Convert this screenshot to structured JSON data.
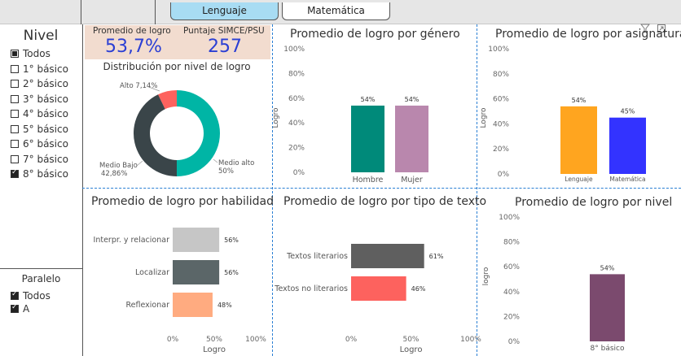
{
  "tabs": [
    {
      "label": "Lenguaje",
      "active": true
    },
    {
      "label": "Matemática",
      "active": false
    }
  ],
  "icons": {
    "filter": "filter-icon",
    "focus": "focus-mode-icon"
  },
  "sidebar": {
    "nivel_title": "Nivel",
    "nivel_items": [
      {
        "label": "Todos",
        "state": "partial"
      },
      {
        "label": "1° básico",
        "state": "unchecked"
      },
      {
        "label": "2° básico",
        "state": "unchecked"
      },
      {
        "label": "3° básico",
        "state": "unchecked"
      },
      {
        "label": "4° básico",
        "state": "unchecked"
      },
      {
        "label": "5° básico",
        "state": "unchecked"
      },
      {
        "label": "6° básico",
        "state": "unchecked"
      },
      {
        "label": "7° básico",
        "state": "unchecked"
      },
      {
        "label": "8° básico",
        "state": "checked"
      }
    ],
    "paralelo_title": "Paralelo",
    "paralelo_items": [
      {
        "label": "Todos",
        "state": "checked"
      },
      {
        "label": "A",
        "state": "checked"
      }
    ]
  },
  "kpi": {
    "logro_label": "Promedio de logro",
    "logro_value": "53,7%",
    "simce_label": "Puntaje SIMCE/PSU",
    "simce_value": "257"
  },
  "colors": {
    "accent": "#2b3fd4",
    "kpi_bg": "#f2dccf",
    "divider": "#2a7fd4"
  },
  "chart_data": [
    {
      "id": "distribucion",
      "type": "pie",
      "title": "Distribución por nivel de logro",
      "slices": [
        {
          "label": "Medio alto",
          "value": 50,
          "display": "50%",
          "color": "#00b5a5"
        },
        {
          "label": "Medio Bajo",
          "value": 42.86,
          "display": "42,86%",
          "color": "#3a4549"
        },
        {
          "label": "Alto",
          "value": 7.14,
          "display": "7,14%",
          "color": "#fd625e"
        }
      ]
    },
    {
      "id": "genero",
      "type": "bar",
      "title": "Promedio de logro por género",
      "ylabel": "Logro",
      "categories": [
        "Hombre",
        "Mujer"
      ],
      "values": [
        54,
        54
      ],
      "labels": [
        "54%",
        "54%"
      ],
      "colors": [
        "#008a7a",
        "#b987ad"
      ],
      "yticks": [
        "0%",
        "20%",
        "40%",
        "60%",
        "80%",
        "100%"
      ],
      "ylim": [
        0,
        100
      ]
    },
    {
      "id": "asignatura",
      "type": "bar",
      "title": "Promedio de logro por asignatura",
      "ylabel": "Logro",
      "categories": [
        "Lenguaje",
        "Matemática"
      ],
      "values": [
        54,
        45
      ],
      "labels": [
        "54%",
        "45%"
      ],
      "colors": [
        "#ffa51f",
        "#3333ff"
      ],
      "yticks": [
        "0%",
        "20%",
        "40%",
        "60%",
        "80%",
        "100%"
      ],
      "ylim": [
        0,
        100
      ]
    },
    {
      "id": "habilidad",
      "type": "bar",
      "orientation": "horizontal",
      "title": "Promedio de logro por habilidad",
      "xlabel": "Logro",
      "categories": [
        "Interpr. y relacionar",
        "Localizar",
        "Reflexionar"
      ],
      "values": [
        56,
        56,
        48
      ],
      "labels": [
        "56%",
        "56%",
        "48%"
      ],
      "colors": [
        "#c6c6c6",
        "#5b6668",
        "#ffab80"
      ],
      "xticks": [
        "0%",
        "50%",
        "100%"
      ],
      "xlim": [
        0,
        100
      ]
    },
    {
      "id": "tipo_texto",
      "type": "bar",
      "orientation": "horizontal",
      "title": "Promedio de logro por tipo de texto",
      "xlabel": "Logro",
      "categories": [
        "Textos literarios",
        "Textos no literarios"
      ],
      "values": [
        61,
        46
      ],
      "labels": [
        "61%",
        "46%"
      ],
      "colors": [
        "#5f5f5f",
        "#fd625e"
      ],
      "xticks": [
        "0%",
        "50%",
        "100%"
      ],
      "xlim": [
        0,
        100
      ]
    },
    {
      "id": "nivel",
      "type": "bar",
      "title": "Promedio de logro por nivel",
      "ylabel": "logro",
      "categories": [
        "8° básico"
      ],
      "values": [
        54
      ],
      "labels": [
        "54%"
      ],
      "colors": [
        "#7b4a6e"
      ],
      "yticks": [
        "0%",
        "20%",
        "40%",
        "60%",
        "80%",
        "100%"
      ],
      "ylim": [
        0,
        100
      ]
    }
  ]
}
